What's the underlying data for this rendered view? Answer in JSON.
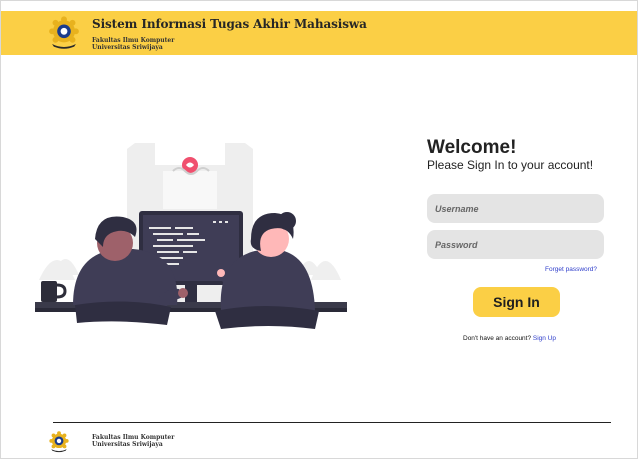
{
  "header": {
    "title": "Sistem Informasi Tugas Akhir Mahasiswa",
    "faculty": "Fakultas Ilmu Komputer",
    "university": "Universitas Sriwijaya",
    "logo_icon": "university-seal-icon"
  },
  "login": {
    "heading": "Welcome!",
    "subheading": "Please Sign In to your account!",
    "username_placeholder": "Username",
    "username_value": "",
    "password_placeholder": "Password",
    "password_value": "",
    "forgot_label": "Forget password?",
    "signin_label": "Sign In",
    "signup_prompt": "Don't have an account? ",
    "signup_label": "Sign Up"
  },
  "footer": {
    "faculty": "Fakultas Ilmu Komputer",
    "university": "Universitas Sriwijaya"
  },
  "colors": {
    "brand": "#fbcf45",
    "link": "#2f3ecb",
    "field_bg": "#e4e4e4"
  }
}
